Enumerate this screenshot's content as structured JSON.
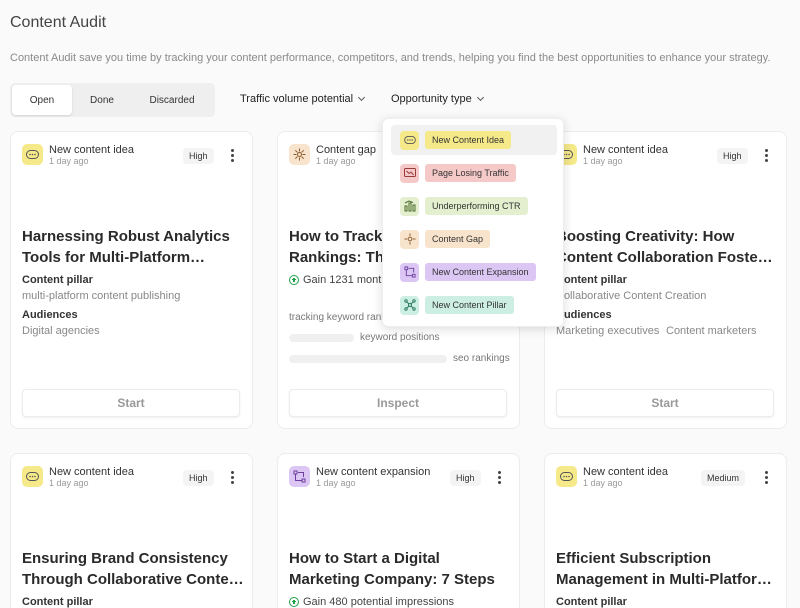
{
  "header": {
    "title": "Content Audit",
    "subtitle": "Content Audit save you time by tracking your content performance, competitors, and trends, helping you find the best opportunities to enhance your strategy."
  },
  "tabs": {
    "open": "Open",
    "done": "Done",
    "discarded": "Discarded",
    "active": "open"
  },
  "filters": {
    "traffic": "Traffic volume potential",
    "opportunity": "Opportunity type"
  },
  "dropdown": {
    "items": [
      {
        "label": "New Content Idea",
        "icon": "content-idea-icon",
        "color": "#f5e98a"
      },
      {
        "label": "Page Losing Traffic",
        "icon": "page-losing-traffic-icon",
        "color": "#f6c9c9"
      },
      {
        "label": "Underperforming CTR",
        "icon": "underperforming-ctr-icon",
        "color": "#e3efcf"
      },
      {
        "label": "Content Gap",
        "icon": "content-gap-icon",
        "color": "#f8e3cc"
      },
      {
        "label": "New Content Expansion",
        "icon": "content-expansion-icon",
        "color": "#dcc6f3"
      },
      {
        "label": "New Content Pillar",
        "icon": "content-pillar-icon",
        "color": "#cdeee3"
      }
    ]
  },
  "cards": [
    {
      "type": "New content idea",
      "date": "1 day ago",
      "priority": "High",
      "title_line1": "Harnessing Robust Analytics",
      "title_line2": "Tools for Multi-Platform…",
      "pillar_label": "Content pillar",
      "pillar": "multi-platform content publishing",
      "audiences_label": "Audiences",
      "audience1": "Digital agencies",
      "action": "Start"
    },
    {
      "type": "Content gap",
      "date": "1 day ago",
      "title_line1": "How to Track",
      "title_line2": "Rankings: The",
      "gain": "Gain 1231 month",
      "kw1": "tracking keyword rankings",
      "kw2": "keyword positions",
      "kw3": "seo rankings",
      "action": "Inspect"
    },
    {
      "type": "New content idea",
      "date": "1 day ago",
      "priority": "High",
      "title_line1": "Boosting Creativity: How",
      "title_line2": "Content Collaboration Foste…",
      "pillar_label": "Content pillar",
      "pillar": "Collaborative Content Creation",
      "audiences_label": "Audiences",
      "audience1": "Marketing executives",
      "audience2": "Content marketers",
      "action": "Start"
    },
    {
      "type": "New content idea",
      "date": "1 day ago",
      "priority": "High",
      "title_line1": "Ensuring Brand Consistency",
      "title_line2": "Through Collaborative Conte…",
      "pillar_label": "Content pillar"
    },
    {
      "type": "New content expansion",
      "date": "1 day ago",
      "priority": "High",
      "title_line1": "How to Start a Digital",
      "title_line2": "Marketing Company: 7 Steps",
      "gain": "Gain 480 potential impressions"
    },
    {
      "type": "New content idea",
      "date": "1 day ago",
      "priority": "Medium",
      "title_line1": "Efficient Subscription",
      "title_line2": "Management in Multi-Platfor…",
      "pillar_label": "Content pillar"
    }
  ],
  "colors": {
    "idea": "#f5e98a",
    "gap": "#f8e3cc",
    "expansion": "#dcc6f3",
    "gain": "#22a34a"
  }
}
